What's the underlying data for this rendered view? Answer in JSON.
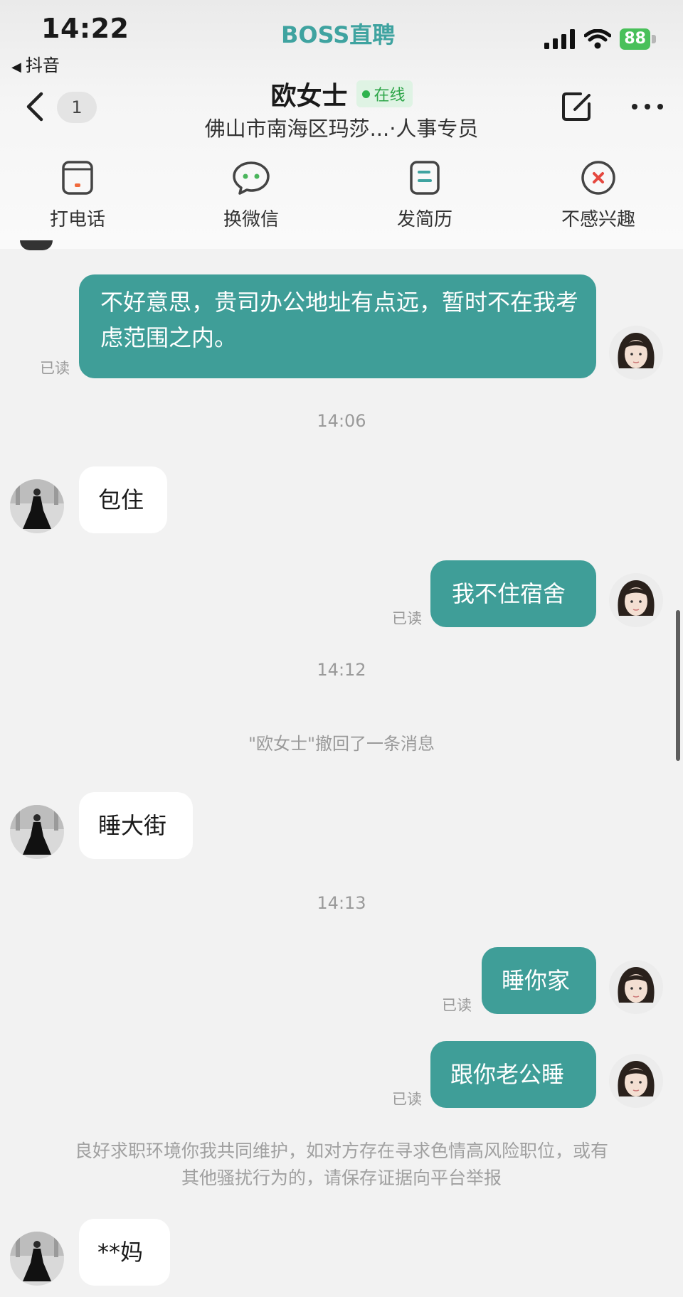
{
  "status_bar": {
    "time": "14:22",
    "app_title": "BOSS直聘",
    "back_app": "抖音",
    "battery": "88"
  },
  "header": {
    "unread_count": "1",
    "contact_name": "欧女士",
    "online_label": "在线",
    "subtitle": "佛山市南海区玛莎...·人事专员"
  },
  "actions": [
    {
      "label": "打电话",
      "icon": "phone-card-icon"
    },
    {
      "label": "换微信",
      "icon": "wechat-icon"
    },
    {
      "label": "发简历",
      "icon": "resume-icon"
    },
    {
      "label": "不感兴趣",
      "icon": "not-interested-icon"
    }
  ],
  "messages": {
    "m1": {
      "text": "不好意思，贵司办公地址有点远，暂时不在我考虑范围之内。",
      "read": "已读"
    },
    "ts1": "14:06",
    "m2": {
      "text": "包住"
    },
    "m3": {
      "text": "我不住宿舍",
      "read": "已读"
    },
    "ts2": "14:12",
    "recall": "\"欧女士\"撤回了一条消息",
    "m4": {
      "text": "睡大街"
    },
    "ts3": "14:13",
    "m5": {
      "text": "睡你家",
      "read": "已读"
    },
    "m6": {
      "text": "跟你老公睡",
      "read": "已读"
    },
    "notice": "良好求职环境你我共同维护，如对方存在寻求色情高风险职位，或有其他骚扰行为的，请保存证据向平台举报",
    "m7": {
      "text": "**妈"
    }
  },
  "colors": {
    "accent": "#3f9e98",
    "brand": "#3fa3a0",
    "online": "#2fa64a"
  }
}
